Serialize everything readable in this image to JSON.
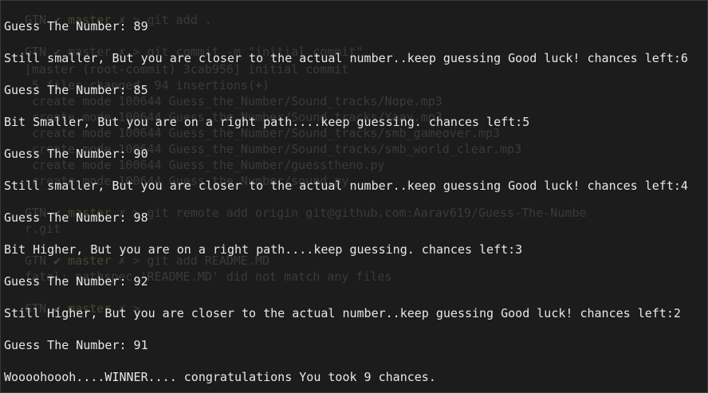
{
  "ghost_lines": [
    {
      "prefix": "GTN ",
      "branch": "✔ master",
      "rest": " ✗ > git add ."
    },
    {
      "prefix": "",
      "branch": "",
      "rest": "GTN ✔ master ✗ > git commit -m \"initial commit\""
    },
    {
      "prefix": "",
      "branch": "",
      "rest": "[master (root-commit) 3cab956] initial commit"
    },
    {
      "prefix": "",
      "branch": "",
      "rest": " 5 files changed, 94 insertions(+)"
    },
    {
      "prefix": "",
      "branch": "",
      "rest": " create mode 100644 Guess_the_Number/Sound_tracks/Nope.mp3"
    },
    {
      "prefix": "",
      "branch": "",
      "rest": " create mode 100644 Guess_the_Number/Sound_tracks/Yaay.mp3"
    },
    {
      "prefix": "",
      "branch": "",
      "rest": " create mode 100644 Guess_the_Number/Sound_tracks/smb_gameover.mp3"
    },
    {
      "prefix": "",
      "branch": "",
      "rest": " create mode 100644 Guess_the_Number/Sound_tracks/smb_world_clear.mp3"
    },
    {
      "prefix": "",
      "branch": "",
      "rest": " create mode 100644 Guess_the_Number/guesstheno.py"
    },
    {
      "prefix": "",
      "branch": "",
      "rest": " create mode 100644 Guess_the_Number/sound.py"
    },
    {
      "prefix": "GTN ",
      "branch": "✔ master",
      "rest": " ✗ > git remote add origin git@github.com:Aarav619/Guess-The-Numbe"
    },
    {
      "prefix": "",
      "branch": "",
      "rest": "r.git"
    },
    {
      "prefix": "GTN ",
      "branch": "✔ master",
      "rest": " ✗ > git add README.MD"
    },
    {
      "prefix": "",
      "branch": "",
      "rest": "fatal: pathspec 'README.MD' did not match any files"
    },
    {
      "prefix": "",
      "branch": "",
      "rest": ""
    },
    {
      "prefix": "GTN ",
      "branch": "✔ master",
      "rest": " ✗ >"
    }
  ],
  "output_lines": [
    "Guess The Number: 89",
    "Still smaller, But you are closer to the actual number..keep guessing Good luck! chances left:6",
    "Guess The Number: 85",
    "Bit Smaller, But you are on a right path....keep guessing. chances left:5",
    "Guess The Number: 90",
    "Still smaller, But you are closer to the actual number..keep guessing Good luck! chances left:4",
    "Guess The Number: 98",
    "Bit Higher, But you are on a right path....keep guessing. chances left:3",
    "Guess The Number: 92",
    "Still Higher, But you are closer to the actual number..keep guessing Good luck! chances left:2",
    "Guess The Number: 91",
    "Woooohoooh....WINNER.... congratulations You took 9 chances."
  ]
}
